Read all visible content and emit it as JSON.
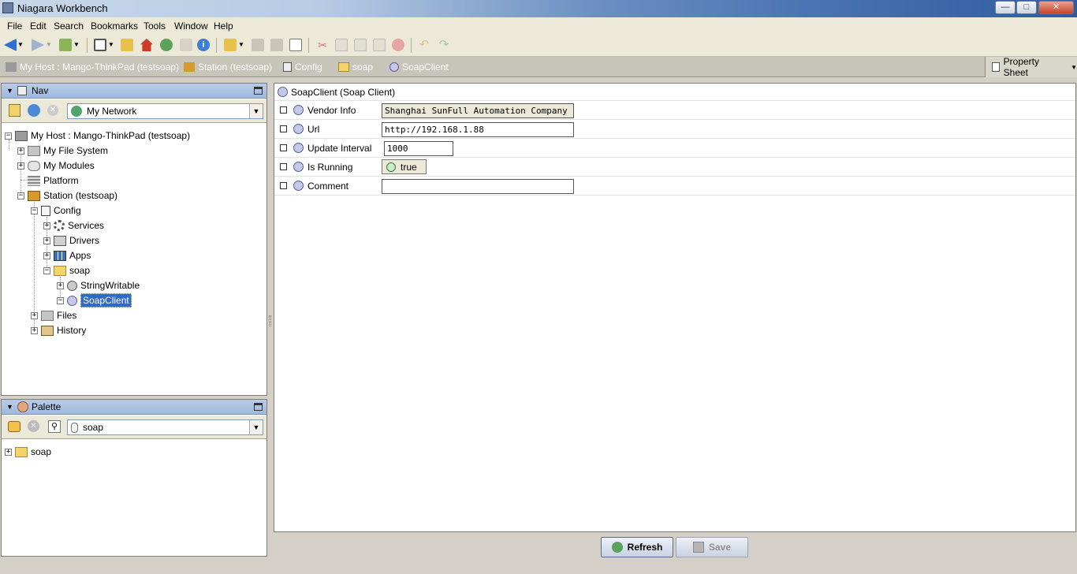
{
  "window": {
    "title": "Niagara Workbench",
    "controls": {
      "minimize": "—",
      "maximize": "□",
      "close": "✕"
    }
  },
  "menu": [
    "File",
    "Edit",
    "Search",
    "Bookmarks",
    "Tools",
    "Window",
    "Help"
  ],
  "breadcrumb": [
    {
      "label": "My Host : Mango-ThinkPad (testsoap)",
      "icon": "host-icon"
    },
    {
      "label": "Station (testsoap)",
      "icon": "station-icon"
    },
    {
      "label": "Config",
      "icon": "config-icon"
    },
    {
      "label": "soap",
      "icon": "folder-icon"
    },
    {
      "label": "SoapClient",
      "icon": "component-icon"
    }
  ],
  "view_selector": {
    "label": "Property Sheet"
  },
  "nav": {
    "title": "Nav",
    "network_combo": "My Network",
    "tree": [
      {
        "label": "My Host : Mango-ThinkPad (testsoap)",
        "icon": "host-icon"
      },
      {
        "label": "My File System",
        "icon": "drive-icon"
      },
      {
        "label": "My Modules",
        "icon": "modules-icon"
      },
      {
        "label": "Platform",
        "icon": "platform-icon"
      },
      {
        "label": "Station (testsoap)",
        "icon": "station-icon"
      },
      {
        "label": "Config",
        "icon": "config-icon"
      },
      {
        "label": "Services",
        "icon": "gear-icon"
      },
      {
        "label": "Drivers",
        "icon": "drivers-icon"
      },
      {
        "label": "Apps",
        "icon": "apps-icon"
      },
      {
        "label": "soap",
        "icon": "folder-icon"
      },
      {
        "label": "StringWritable",
        "icon": "component-icon"
      },
      {
        "label": "SoapClient",
        "icon": "component-icon"
      },
      {
        "label": "Files",
        "icon": "drive-icon"
      },
      {
        "label": "History",
        "icon": "history-icon"
      }
    ]
  },
  "palette": {
    "title": "Palette",
    "combo": "soap",
    "tree": [
      {
        "label": "soap",
        "icon": "folder-icon"
      }
    ]
  },
  "property_sheet": {
    "header": "SoapClient  (Soap Client)",
    "rows": [
      {
        "label": "Vendor Info",
        "value": "Shanghai SunFull Automation Company ltd."
      },
      {
        "label": "Url",
        "value": "http://192.168.1.88"
      },
      {
        "label": "Update Interval",
        "value": "1000"
      },
      {
        "label": "Is Running",
        "value": "true"
      },
      {
        "label": "Comment",
        "value": ""
      }
    ]
  },
  "buttons": {
    "refresh": "Refresh",
    "save": "Save"
  },
  "colors": {
    "selection": "#316ac5",
    "panel_header": "#b8cce8"
  }
}
